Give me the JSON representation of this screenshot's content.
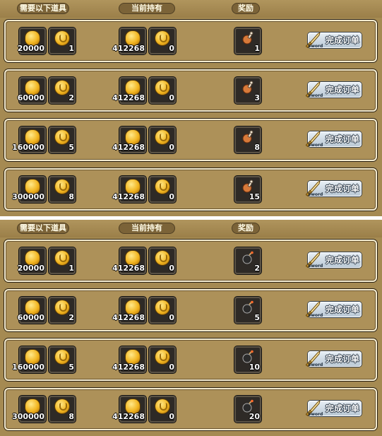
{
  "headers": {
    "required": "需要以下道具",
    "owned": "当前持有",
    "reward": "奖励"
  },
  "button": {
    "label": "完成订单",
    "sub": "Sword"
  },
  "panels": [
    {
      "reward_icon": "meat-icon",
      "rows": [
        {
          "req_coin": "20000",
          "req_token": "1",
          "own_coin": "412268",
          "own_token": "0",
          "reward": "1"
        },
        {
          "req_coin": "60000",
          "req_token": "2",
          "own_coin": "412268",
          "own_token": "0",
          "reward": "3"
        },
        {
          "req_coin": "160000",
          "req_token": "5",
          "own_coin": "412268",
          "own_token": "0",
          "reward": "8"
        },
        {
          "req_coin": "300000",
          "req_token": "8",
          "own_coin": "412268",
          "own_token": "0",
          "reward": "15"
        }
      ]
    },
    {
      "reward_icon": "bomb-icon",
      "rows": [
        {
          "req_coin": "20000",
          "req_token": "1",
          "own_coin": "412268",
          "own_token": "0",
          "reward": "2"
        },
        {
          "req_coin": "60000",
          "req_token": "2",
          "own_coin": "412268",
          "own_token": "0",
          "reward": "5"
        },
        {
          "req_coin": "160000",
          "req_token": "5",
          "own_coin": "412268",
          "own_token": "0",
          "reward": "10"
        },
        {
          "req_coin": "300000",
          "req_token": "8",
          "own_coin": "412268",
          "own_token": "0",
          "reward": "20"
        }
      ]
    }
  ],
  "icons": {
    "coin": "gold-coin-icon",
    "token": "gold-token-icon",
    "button": "sword-icon"
  },
  "colors": {
    "panel": "#a58a52",
    "header_pill": "#7b6338",
    "slot": "#2e2a26",
    "row_border": "#f5ecd0"
  }
}
